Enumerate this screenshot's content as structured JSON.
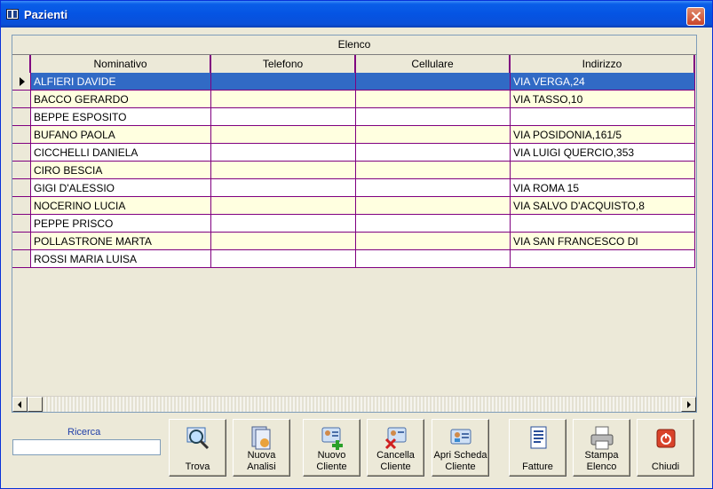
{
  "window": {
    "title": "Pazienti"
  },
  "grid": {
    "group_header": "Elenco",
    "columns": [
      "Nominativo",
      "Telefono",
      "Cellulare",
      "Indirizzo"
    ],
    "rows": [
      {
        "nominativo": "ALFIERI DAVIDE",
        "telefono": "",
        "cellulare": "",
        "indirizzo": "VIA VERGA,24",
        "selected": true
      },
      {
        "nominativo": "BACCO GERARDO",
        "telefono": "",
        "cellulare": "",
        "indirizzo": "VIA TASSO,10",
        "selected": false
      },
      {
        "nominativo": "BEPPE ESPOSITO",
        "telefono": "",
        "cellulare": "",
        "indirizzo": "",
        "selected": false
      },
      {
        "nominativo": "BUFANO PAOLA",
        "telefono": "",
        "cellulare": "",
        "indirizzo": "VIA POSIDONIA,161/5",
        "selected": false
      },
      {
        "nominativo": "CICCHELLI DANIELA",
        "telefono": "",
        "cellulare": "",
        "indirizzo": "VIA LUIGI QUERCIO,353",
        "selected": false
      },
      {
        "nominativo": "CIRO BESCIA",
        "telefono": "",
        "cellulare": "",
        "indirizzo": "",
        "selected": false
      },
      {
        "nominativo": "GIGI D'ALESSIO",
        "telefono": "",
        "cellulare": "",
        "indirizzo": "VIA ROMA 15",
        "selected": false
      },
      {
        "nominativo": "NOCERINO LUCIA",
        "telefono": "",
        "cellulare": "",
        "indirizzo": "VIA SALVO D'ACQUISTO,8",
        "selected": false
      },
      {
        "nominativo": "PEPPE PRISCO",
        "telefono": "",
        "cellulare": "",
        "indirizzo": "",
        "selected": false
      },
      {
        "nominativo": "POLLASTRONE MARTA",
        "telefono": "",
        "cellulare": "",
        "indirizzo": "VIA SAN FRANCESCO DI",
        "selected": false
      },
      {
        "nominativo": "ROSSI MARIA LUISA",
        "telefono": "",
        "cellulare": "",
        "indirizzo": "",
        "selected": false
      }
    ]
  },
  "search": {
    "label": "Ricerca",
    "value": ""
  },
  "buttons": [
    {
      "name": "trova-button",
      "icon": "magnifier-icon",
      "label": "Trova"
    },
    {
      "name": "nuova-analisi-button",
      "icon": "analysis-icon",
      "label": "Nuova\nAnalisi"
    },
    {
      "name": "nuovo-cliente-button",
      "icon": "add-client-icon",
      "label": "Nuovo\nCliente"
    },
    {
      "name": "cancella-cliente-button",
      "icon": "delete-client-icon",
      "label": "Cancella\nCliente"
    },
    {
      "name": "apri-scheda-button",
      "icon": "client-card-icon",
      "label": "Apri Scheda\nCliente"
    },
    {
      "name": "fatture-button",
      "icon": "invoice-document-icon",
      "label": "Fatture"
    },
    {
      "name": "stampa-elenco-button",
      "icon": "printer-icon",
      "label": "Stampa\nElenco"
    },
    {
      "name": "chiudi-button",
      "icon": "power-icon",
      "label": "Chiudi"
    }
  ],
  "colors": {
    "selected_row": "#316ac5",
    "alt_row": "#ffffe0",
    "row": "#ffffff",
    "grid_lines": "#800080",
    "title_bar": "#0554e3"
  }
}
